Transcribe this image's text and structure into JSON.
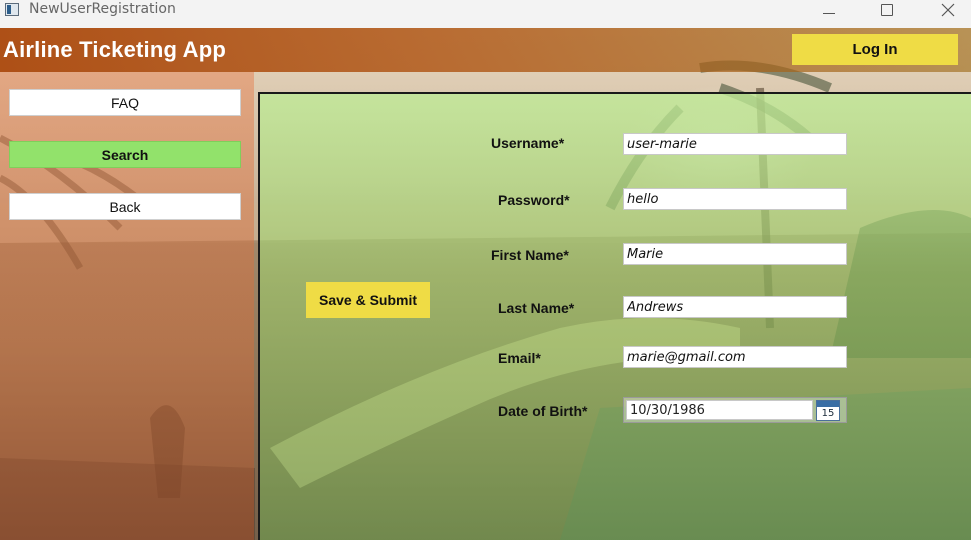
{
  "window": {
    "title": "NewUserRegistration"
  },
  "header": {
    "app_title": "Airline Ticketing App",
    "login_label": "Log In"
  },
  "sidebar": {
    "items": [
      {
        "label": "FAQ"
      },
      {
        "label": "Search"
      },
      {
        "label": "Back"
      }
    ]
  },
  "form": {
    "save_label": "Save & Submit",
    "username": {
      "label": "Username*",
      "value": "user-marie"
    },
    "password": {
      "label": "Password*",
      "value": "hello"
    },
    "first_name": {
      "label": "First Name*",
      "value": "Marie"
    },
    "last_name": {
      "label": "Last Name*",
      "value": "Andrews"
    },
    "email": {
      "label": "Email*",
      "value": "marie@gmail.com"
    },
    "dob": {
      "label": "Date of Birth*",
      "value": "10/30/1986",
      "calendar_day": "15"
    }
  },
  "colors": {
    "accent_yellow": "#efdc45",
    "active_nav_green": "#92e26b",
    "header_orange": "#aa460a"
  },
  "icons": {
    "app": "window-app-icon",
    "calendar": "calendar-icon"
  }
}
